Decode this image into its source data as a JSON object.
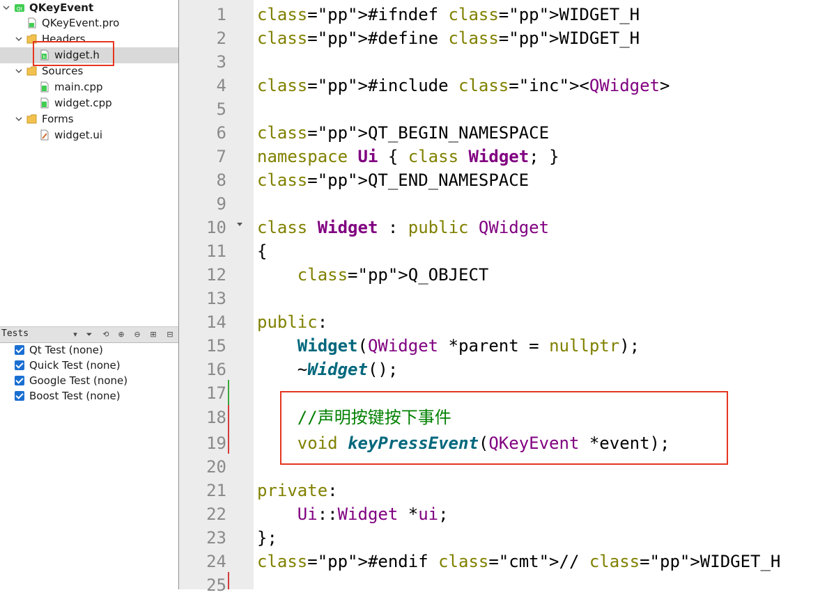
{
  "project_tree": {
    "project": "QKeyEvent",
    "pro_file": "QKeyEvent.pro",
    "folders": [
      {
        "label": "Headers",
        "files": [
          "widget.h"
        ]
      },
      {
        "label": "Sources",
        "files": [
          "main.cpp",
          "widget.cpp"
        ]
      },
      {
        "label": "Forms",
        "files": [
          "widget.ui"
        ]
      }
    ],
    "selected_file": "widget.h"
  },
  "tests_panel": {
    "title": "Tests",
    "items": [
      {
        "label": "Qt Test (none)",
        "checked": true
      },
      {
        "label": "Quick Test (none)",
        "checked": true
      },
      {
        "label": "Google Test (none)",
        "checked": true
      },
      {
        "label": "Boost Test (none)",
        "checked": true
      }
    ]
  },
  "editor": {
    "line_numbers": [
      "1",
      "2",
      "3",
      "4",
      "5",
      "6",
      "7",
      "8",
      "9",
      "10",
      "11",
      "12",
      "13",
      "14",
      "15",
      "16",
      "17",
      "18",
      "19",
      "20",
      "21",
      "22",
      "23",
      "24",
      "25"
    ],
    "lines": [
      "#ifndef WIDGET_H",
      "#define WIDGET_H",
      "",
      "#include <QWidget>",
      "",
      "QT_BEGIN_NAMESPACE",
      "namespace Ui { class Widget; }",
      "QT_END_NAMESPACE",
      "",
      "class Widget : public QWidget",
      "{",
      "    Q_OBJECT",
      "",
      "public:",
      "    Widget(QWidget *parent = nullptr);",
      "    ~Widget();",
      "",
      "    //声明按键按下事件",
      "    void keyPressEvent(QKeyEvent *event);",
      "",
      "private:",
      "    Ui::Widget *ui;",
      "};",
      "#endif // WIDGET_H",
      ""
    ]
  },
  "colors": {
    "highlight_border": "#e4351f",
    "preprocessor": "#000080",
    "keyword": "#808000",
    "class_name": "#800080",
    "function": "#00677c",
    "comment": "#008000",
    "checkbox": "#1a6fd1"
  }
}
